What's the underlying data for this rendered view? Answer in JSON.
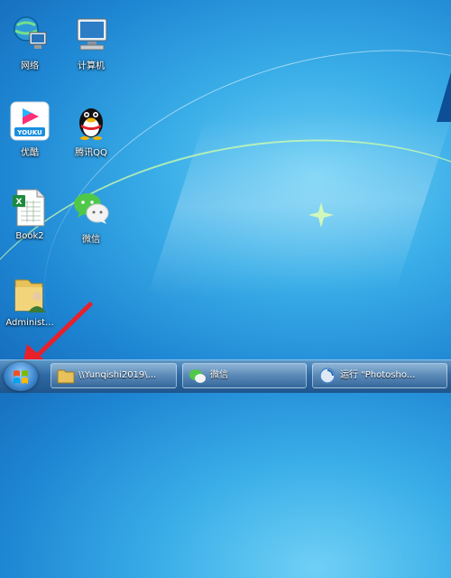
{
  "desktop": {
    "icons": [
      {
        "label": "网络",
        "icon": "network-icon"
      },
      {
        "label": "计算机",
        "icon": "computer-icon"
      },
      {
        "label": "优酷",
        "icon": "youku-icon",
        "logo_text": "YOUKU"
      },
      {
        "label": "腾讯QQ",
        "icon": "qq-penguin-icon"
      },
      {
        "label": "Book2",
        "icon": "excel-file-icon"
      },
      {
        "label": "微信",
        "icon": "wechat-icon"
      },
      {
        "label": "Administ...",
        "icon": "user-folder-icon"
      }
    ]
  },
  "taskbar": {
    "start_icon": "windows-start-icon",
    "buttons": [
      {
        "label": "\\\\Yunqishi2019\\...",
        "icon": "folder-icon"
      },
      {
        "label": "微信",
        "icon": "wechat-icon"
      },
      {
        "label": "运行 \"Photosho...",
        "icon": "photoshop-loading-icon"
      }
    ]
  },
  "colors": {
    "desktop_blue": "#2a9be0",
    "taskbar": "#2f6aa4",
    "arrow": "#e8202a",
    "youku_pink": "#ff2f78",
    "wechat_green": "#4fc84a"
  }
}
